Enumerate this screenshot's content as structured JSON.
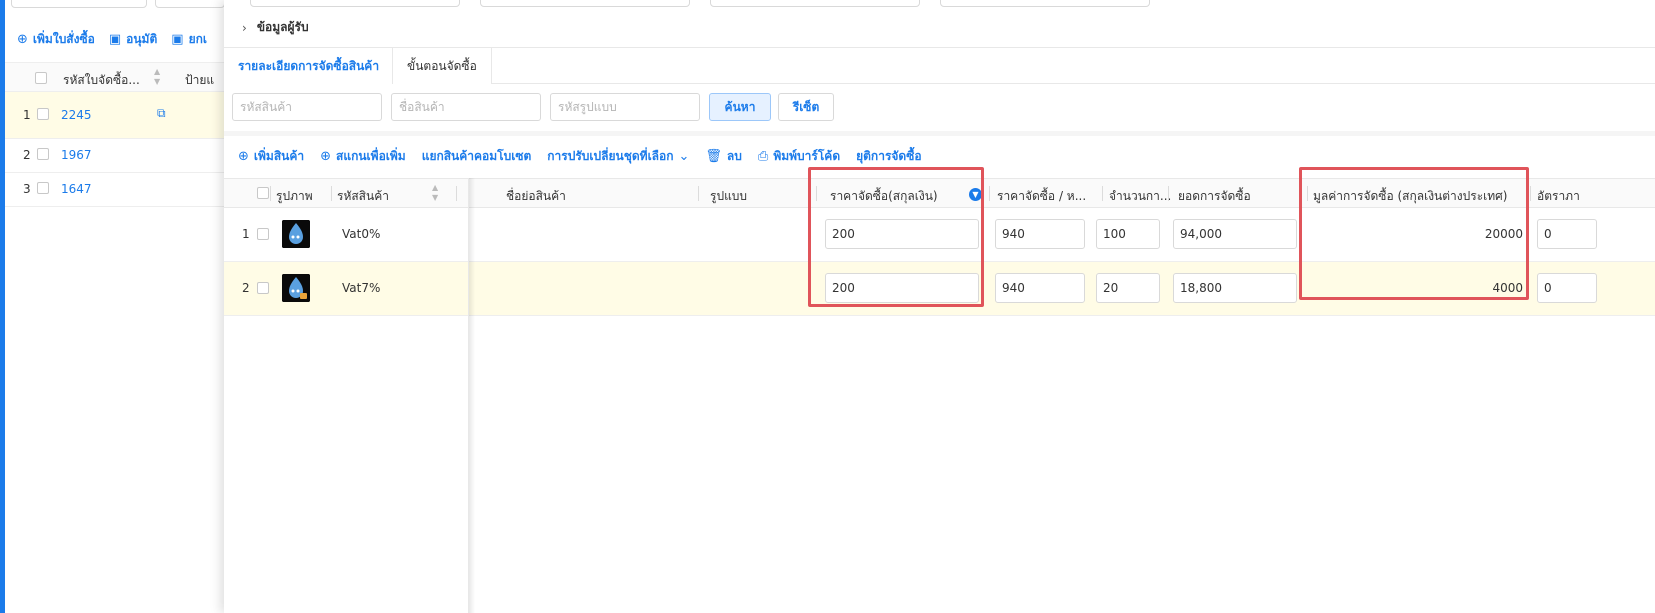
{
  "background_list": {
    "toolbar": [
      {
        "icon": "plus-circle-icon",
        "glyph": "⊕",
        "label": "เพิ่มใบสั่งซื้อ"
      },
      {
        "icon": "approve-icon",
        "glyph": "▣",
        "label": "อนุมัติ"
      },
      {
        "icon": "cancel-icon",
        "glyph": "▣",
        "label": "ยกเ"
      }
    ],
    "columns": {
      "code": "รหัสใบจัดซื้อ...",
      "label": "ป้ายแ"
    },
    "rows": [
      {
        "num": "1",
        "code": "2245"
      },
      {
        "num": "2",
        "code": "1967"
      },
      {
        "num": "3",
        "code": "1647"
      }
    ]
  },
  "drawer": {
    "collapse_section": {
      "icon": "chevron-right-icon",
      "glyph": "›",
      "label": "ข้อมูลผู้รับ"
    },
    "tabs": [
      {
        "label": "รายละเอียดการจัดซื้อสินค้า",
        "active": true
      },
      {
        "label": "ขั้นตอนจัดซื้อ",
        "active": false
      }
    ],
    "search": {
      "product_code_placeholder": "รหัสสินค้า",
      "product_name_placeholder": "ชื่อสินค้า",
      "model_code_placeholder": "รหัสรูปแบบ",
      "search_label": "ค้นหา",
      "reset_label": "รีเซ็ต"
    },
    "toolbar": [
      {
        "icon": "plus-circle-icon",
        "glyph": "⊕",
        "label": "เพิ่มสินค้า"
      },
      {
        "icon": "scan-plus-icon",
        "glyph": "⊕",
        "label": "สแกนเพื่อเพิ่ม"
      },
      {
        "icon": "",
        "glyph": "",
        "label": "แยกสินค้าคอมโบเซต"
      },
      {
        "icon": "chevron-down-icon",
        "glyph": "⌄",
        "label": "การปรับเปลี่ยนชุดที่เลือก"
      },
      {
        "icon": "trash-icon",
        "glyph": "🗑",
        "label": "ลบ"
      },
      {
        "icon": "printer-icon",
        "glyph": "⎙",
        "label": "พิมพ์บาร์โค้ด"
      },
      {
        "icon": "",
        "glyph": "",
        "label": "ยุติการจัดซื้อ"
      }
    ],
    "table": {
      "headers": {
        "image": "รูปภาพ",
        "product_code": "รหัสสินค้า",
        "short_name": "ชื่อย่อสินค้า",
        "model": "รูปแบบ",
        "purchase_price_currency": "ราคาจัดซื้อ(สกุลเงิน)",
        "purchase_price_per_unit": "ราคาจัดซื้อ / ห...",
        "quantity": "จำนวนกา...",
        "purchase_total": "ยอดการจัดซื้อ",
        "foreign_value": "มูลค่าการจัดซื้อ (สกุลเงินต่างประเทศ)",
        "rate": "อัตราภา"
      },
      "rows": [
        {
          "num": "1",
          "product_code": "Vat0%",
          "price_currency": "200",
          "price_unit": "940",
          "quantity": "100",
          "total": "94,000",
          "foreign_value": "20000",
          "rate": "0"
        },
        {
          "num": "2",
          "product_code": "Vat7%",
          "price_currency": "200",
          "price_unit": "940",
          "quantity": "20",
          "total": "18,800",
          "foreign_value": "4000",
          "rate": "0"
        }
      ]
    }
  },
  "colors": {
    "accent": "#1b7bea",
    "highlight_row": "#fffce6",
    "annotation_red": "#e0545a"
  }
}
